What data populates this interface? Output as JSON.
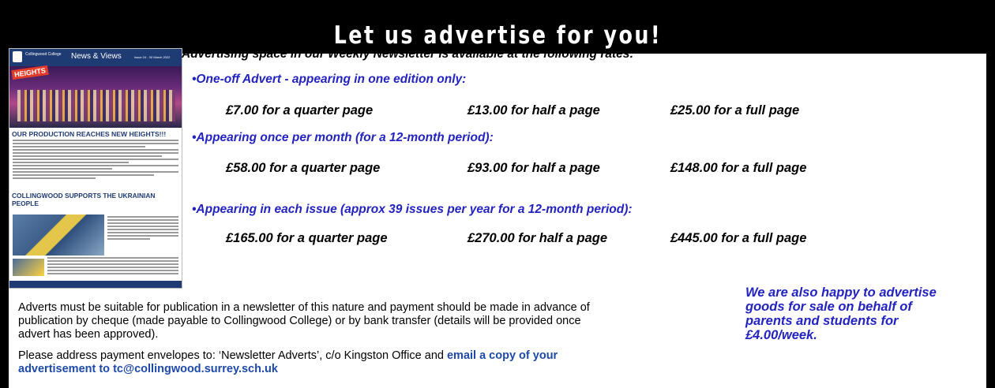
{
  "banner": {
    "title": "Let us advertise for you!"
  },
  "newsletter": {
    "school": "Collingwood College",
    "title": "News & Views",
    "issue": "Issue 24 - 30 March 2022",
    "badge": "HEIGHTS",
    "headline1": "OUR PRODUCTION REACHES NEW HEIGHTS!!!",
    "headline2": "COLLINGWOOD SUPPORTS THE UKRAINIAN PEOPLE"
  },
  "intro": "Advertising space in our Weekly Newsletter is available at the following rates:",
  "rates": [
    {
      "heading": "•One-off Advert - appearing in one edition only:",
      "quarter": "£7.00 for a quarter page",
      "half": "£13.00 for half a page",
      "full": "£25.00 for a full page"
    },
    {
      "heading": "•Appearing once per month (for a 12-month period):",
      "quarter": "£58.00 for a quarter page",
      "half": "£93.00 for half a page",
      "full": "£148.00 for a full page"
    },
    {
      "heading": "•Appearing in each issue (approx 39  issues per year for a 12-month period):",
      "quarter": "£165.00 for a quarter page",
      "half": "£270.00 for half a page",
      "full": "£445.00 for a full page"
    }
  ],
  "terms": {
    "line1": "Adverts must be suitable for publication in a newsletter of this nature and payment should be made in advance of",
    "line2": "publication by cheque (made payable to Collingwood College) or by bank transfer (details will be provided once",
    "line3": "advert has been approved).",
    "address": "Please address payment envelopes to:  ‘Newsletter Adverts’, c/o Kingston Office and ",
    "email_a": "email a copy of your",
    "email_b": "advertisement to tc@collingwood.surrey.sch.uk"
  },
  "also": "We are also happy to advertise goods for sale on behalf of parents and students for £4.00/week.",
  "colors": {
    "heading_blue": "#2323c0",
    "email_blue": "#1d4aa8",
    "banner": "#000000"
  }
}
